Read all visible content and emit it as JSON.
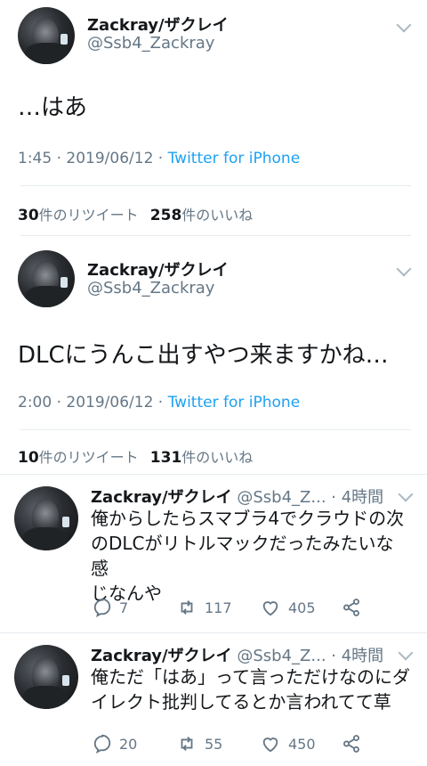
{
  "tweet1": {
    "name": "Zackray/ザクレイ",
    "handle": "@Ssb4_Zackray",
    "text": "…はあ",
    "time": "1:45",
    "date": "2019/06/12",
    "source": "Twitter for iPhone",
    "retweets": "30",
    "retweets_label": "件のリツイート",
    "likes": "258",
    "likes_label": "件のいいね"
  },
  "tweet2": {
    "name": "Zackray/ザクレイ",
    "handle": "@Ssb4_Zackray",
    "text": "DLCにうんこ出すやつ来ますかね…",
    "time": "2:00",
    "date": "2019/06/12",
    "source": "Twitter for iPhone",
    "retweets": "10",
    "retweets_label": "件のリツイート",
    "likes": "131",
    "likes_label": "件のいいね"
  },
  "replies": [
    {
      "name": "Zackray/ザクレイ",
      "handle": "@Ssb4_Z...",
      "age": "· 4時間",
      "lines": [
        "俺からしたらスマブラ4でクラウドの次",
        "のDLCがリトルマックだったみたいな感",
        "じなんや"
      ],
      "replies": "7",
      "retweets": "117",
      "likes": "405"
    },
    {
      "name": "Zackray/ザクレイ",
      "handle": "@Ssb4_Z...",
      "age": "· 4時間",
      "lines": [
        "俺ただ「はあ」って言っただけなのにダ",
        "イレクト批判してるとか言われてて草"
      ],
      "replies": "20",
      "retweets": "55",
      "likes": "450"
    }
  ],
  "colors": {
    "link": "#1da1f2",
    "muted": "#657786",
    "text": "#14171a",
    "divider": "#e6ecf0"
  },
  "icons": [
    "chevron-down-icon",
    "reply-icon",
    "retweet-icon",
    "like-icon",
    "share-icon"
  ]
}
